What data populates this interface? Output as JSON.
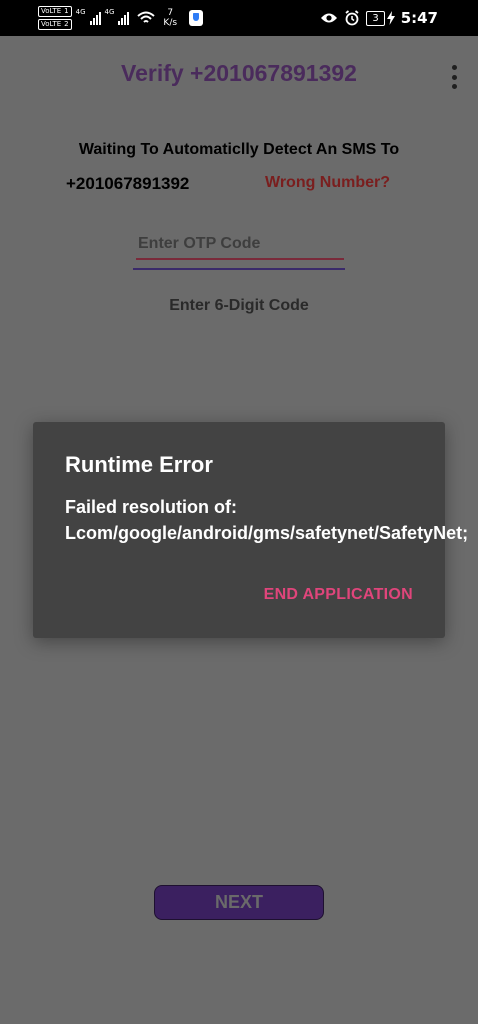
{
  "status_bar": {
    "volte_1": "VoLTE",
    "sim_1": "1",
    "volte_2": "VoLTE",
    "sim_2": "2",
    "network_1": "4G",
    "network_2": "4G",
    "speed_value": "7",
    "speed_unit": "K/s",
    "battery": "3",
    "time": "5:47"
  },
  "header": {
    "title": "Verify +201067891392"
  },
  "verify": {
    "waiting_text": "Waiting To Automaticlly Detect An SMS To",
    "phone_number": "+201067891392",
    "wrong_number": "Wrong Number?",
    "otp_placeholder": "Enter OTP Code",
    "otp_value": "",
    "hint": "Enter 6-Digit Code"
  },
  "dialog": {
    "title": "Runtime Error",
    "message": "Failed resolution of: Lcom/google/android/gms/safetynet/SafetyNet;",
    "button": "END APPLICATION"
  },
  "footer": {
    "next_label": "NEXT"
  },
  "colors": {
    "title": "#4a2b5c",
    "wrong_number": "#7a1e1e",
    "dialog_background": "#434343",
    "dialog_button": "#e0457b",
    "next_button": "#3b2060"
  }
}
